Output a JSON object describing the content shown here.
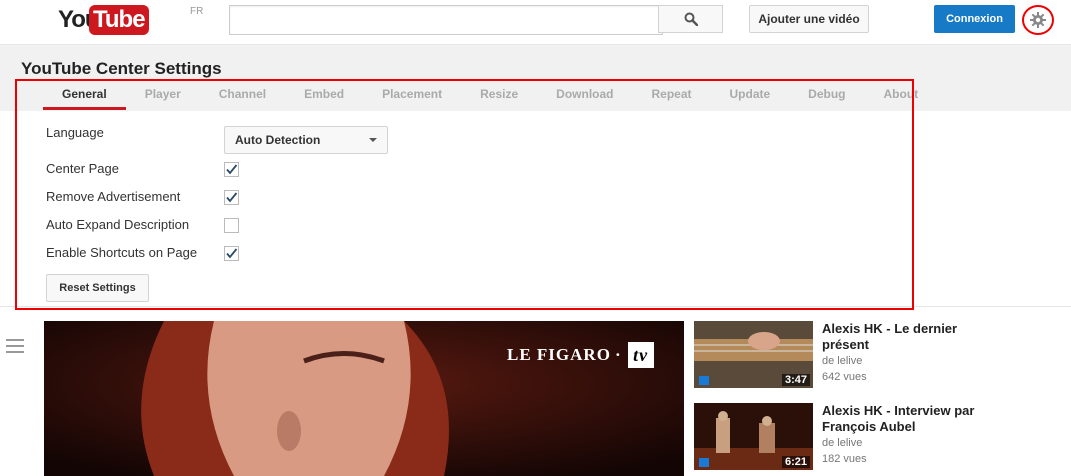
{
  "masthead": {
    "logo_you": "You",
    "logo_tube": "Tube",
    "logo_country": "FR",
    "search_placeholder": "",
    "upload_label": "Ajouter une vidéo",
    "signin_label": "Connexion"
  },
  "settings": {
    "title": "YouTube Center Settings",
    "tabs": [
      "General",
      "Player",
      "Channel",
      "Embed",
      "Placement",
      "Resize",
      "Download",
      "Repeat",
      "Update",
      "Debug",
      "About"
    ],
    "active_tab": "General",
    "language_label": "Language",
    "language_value": "Auto Detection",
    "options": [
      {
        "label": "Center Page",
        "checked": true
      },
      {
        "label": "Remove Advertisement",
        "checked": true
      },
      {
        "label": "Auto Expand Description",
        "checked": false
      },
      {
        "label": "Enable Shortcuts on Page",
        "checked": true
      }
    ],
    "reset_label": "Reset Settings"
  },
  "player": {
    "watermark_text": "LE FIGARO",
    "watermark_dot": "·",
    "watermark_tv": "tv"
  },
  "related": [
    {
      "title": "Alexis HK - Le dernier présent",
      "channel": "de lelive",
      "views": "642 vues",
      "duration": "3:47"
    },
    {
      "title": "Alexis HK - Interview par François Aubel",
      "channel": "de lelive",
      "views": "182 vues",
      "duration": "6:21"
    }
  ],
  "colors": {
    "brand_red": "#cc181e",
    "signin_blue": "#167ac6",
    "annotation_red": "#ee0000"
  }
}
